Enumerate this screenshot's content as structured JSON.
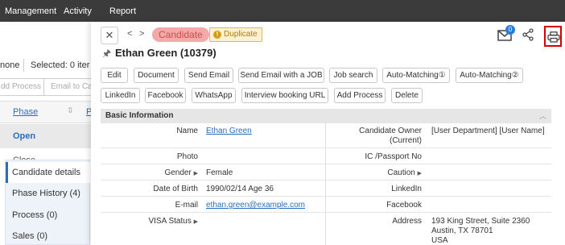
{
  "topnav": {
    "management": "Management",
    "activity": "Activity",
    "report": "Report"
  },
  "background": {
    "none_label": "none",
    "selected_label": "Selected: 0 iter",
    "add_process": "dd Process",
    "email_to_ca": "Email to Ca",
    "phase_header": "Phase",
    "p_header": "P",
    "open_label": "Open",
    "close_label": "Close"
  },
  "left_tabs": [
    {
      "label": "Candidate details"
    },
    {
      "label": "Phase History (4)"
    },
    {
      "label": "Process (0)"
    },
    {
      "label": "Sales (0)"
    }
  ],
  "panel": {
    "candidate_badge": "Candidate",
    "duplicate_badge": "Duplicate",
    "name_title": "Ethan Green (10379)",
    "mail_count": "0",
    "buttons_row1": [
      "Edit",
      "Document",
      "Send Email",
      "Send Email with a JOB",
      "Job search",
      "Auto-Matching①",
      "Auto-Matching②"
    ],
    "buttons_row2": [
      "LinkedIn",
      "Facebook",
      "WhatsApp",
      "Interview booking URL",
      "Add Process",
      "Delete"
    ]
  },
  "basic_info": {
    "section_title": "Basic Information",
    "name_label": "Name",
    "name_value": "Ethan Green",
    "owner_label_1": "Candidate Owner",
    "owner_label_2": "(Current)",
    "owner_value": "[User Department] [User Name]",
    "photo_label": "Photo",
    "ic_label": "IC /Passport No",
    "gender_label": "Gender",
    "gender_value": "Female",
    "caution_label": "Caution",
    "dob_label": "Date of Birth",
    "dob_value": "1990/02/14 Age 36",
    "linkedin_label": "LinkedIn",
    "email_label": "E-mail",
    "email_value": "ethan.green@example.com",
    "facebook_label": "Facebook",
    "visa_label": "VISA Status",
    "address_label": "Address",
    "address_line1": "193 King Street, Suite 2360",
    "address_line2": "Austin, TX 78701",
    "address_line3": "USA"
  }
}
